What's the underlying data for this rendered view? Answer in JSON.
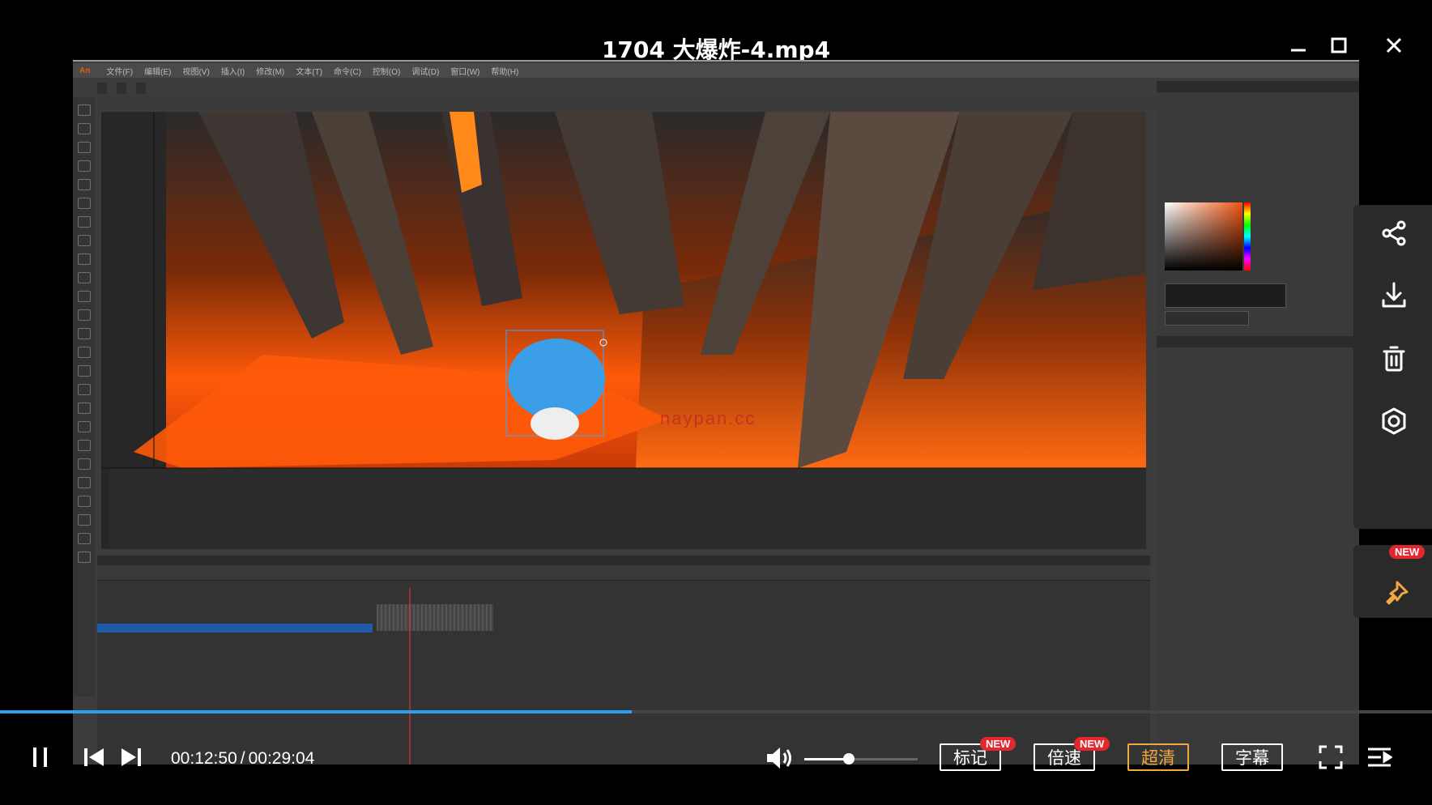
{
  "window": {
    "title": "1704 大爆炸-4.mp4",
    "icons": [
      "minimize-icon",
      "maximize-icon",
      "close-icon"
    ]
  },
  "app": {
    "logo": "An",
    "menu": [
      "文件(F)",
      "编辑(E)",
      "视图(V)",
      "插入(I)",
      "修改(M)",
      "文本(T)",
      "命令(C)",
      "控制(O)",
      "调试(D)",
      "窗口(W)",
      "帮助(H)"
    ],
    "watermark": "naypan.cc"
  },
  "player": {
    "current_time": "00:12:50",
    "time_separator": "/",
    "total_time": "00:29:04",
    "progress_fraction": 0.441,
    "volume_fraction": 0.39,
    "buttons": {
      "mark": "标记",
      "speed": "倍速",
      "quality": "超清",
      "subtitle": "字幕"
    },
    "badge_new": "NEW",
    "accent_color": "#2aa0ee",
    "active_color": "#f0a940",
    "badge_color": "#e4272e"
  },
  "side_actions": [
    "share-icon",
    "download-icon",
    "delete-icon",
    "target-icon",
    "pin-icon"
  ]
}
